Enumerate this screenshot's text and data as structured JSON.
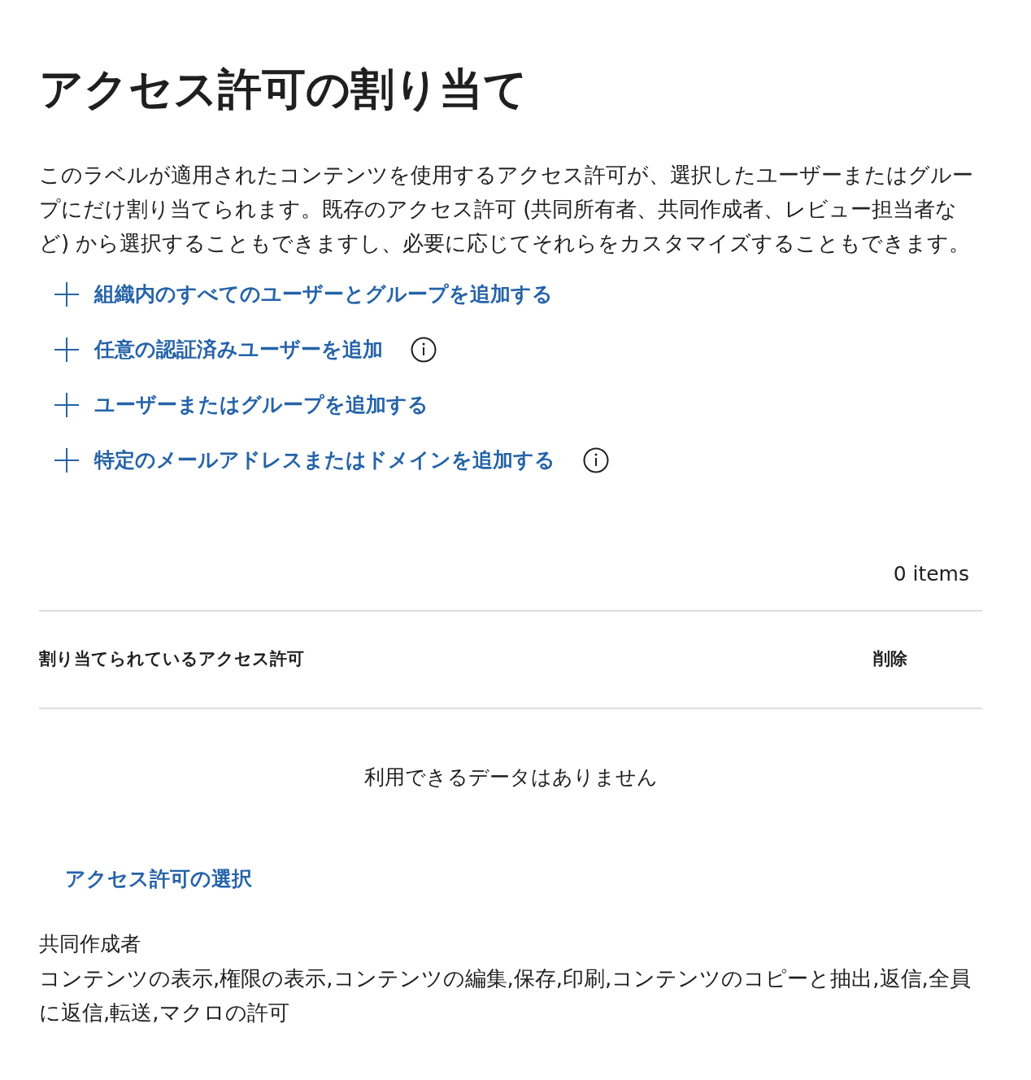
{
  "title": "アクセス許可の割り当て",
  "description": "このラベルが適用されたコンテンツを使用するアクセス許可が、選択したユーザーまたはグループにだけ割り当てられます。既存のアクセス許可 (共同所有者、共同作成者、レビュー担当者など) から選択することもできますし、必要に応じてそれらをカスタマイズすることもできます。",
  "add_actions": [
    {
      "label": "組織内のすべてのユーザーとグループを追加する",
      "info": false
    },
    {
      "label": "任意の認証済みユーザーを追加",
      "info": true
    },
    {
      "label": "ユーザーまたはグループを追加する",
      "info": false
    },
    {
      "label": "特定のメールアドレスまたはドメインを追加する",
      "info": true
    }
  ],
  "item_count": "0 items",
  "table": {
    "columns": [
      "割り当てられているアクセス許可",
      "削除"
    ],
    "empty_message": "利用できるデータはありません"
  },
  "permission_selection": {
    "link": "アクセス許可の選択",
    "role": "共同作成者",
    "permissions": "コンテンツの表示,権限の表示,コンテンツの編集,保存,印刷,コンテンツのコピーと抽出,返信,全員に返信,転送,マクロの許可"
  }
}
